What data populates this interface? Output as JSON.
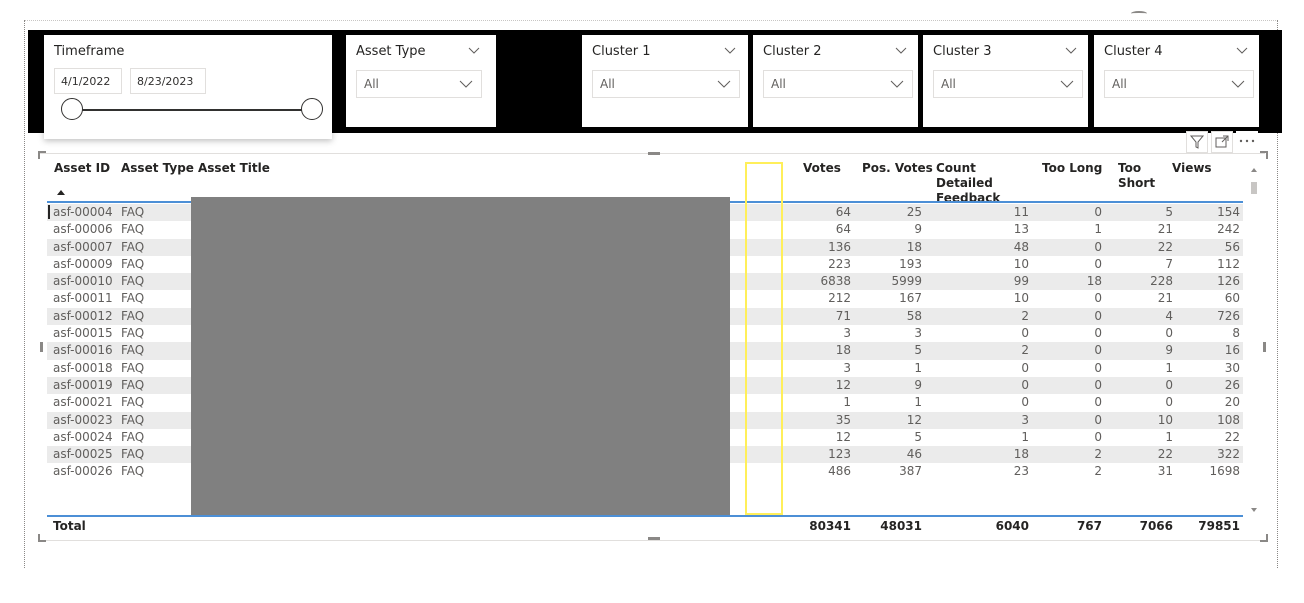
{
  "timeframe": {
    "title": "Timeframe",
    "start_date": "4/1/2022",
    "end_date": "8/23/2023"
  },
  "slicers": [
    {
      "title": "Asset Type",
      "value": "All"
    },
    {
      "title": "Cluster 1",
      "value": "All"
    },
    {
      "title": "Cluster 2",
      "value": "All"
    },
    {
      "title": "Cluster 3",
      "value": "All"
    },
    {
      "title": "Cluster 4",
      "value": "All"
    }
  ],
  "icons": [
    "filter-icon",
    "focus-mode-icon",
    "more-options-icon",
    "chevron-down-icon",
    "sort-ascending-icon"
  ],
  "colors": {
    "accent": "#4c8fd6",
    "highlight": "#ffef5a",
    "band": "#000000",
    "redaction": "#808080",
    "row_alt": "#ebebeb"
  },
  "table": {
    "columns": [
      "Asset ID",
      "Asset Type",
      "Asset Title",
      "Votes",
      "Pos. Votes",
      "Count Detailed Feedback",
      "Too Long",
      "Too Short",
      "Views"
    ],
    "rows": [
      [
        "asf-00004",
        "FAQ",
        "64",
        "25",
        "11",
        "0",
        "5",
        "154"
      ],
      [
        "asf-00006",
        "FAQ",
        "64",
        "9",
        "13",
        "1",
        "21",
        "242"
      ],
      [
        "asf-00007",
        "FAQ",
        "136",
        "18",
        "48",
        "0",
        "22",
        "56"
      ],
      [
        "asf-00009",
        "FAQ",
        "223",
        "193",
        "10",
        "0",
        "7",
        "112"
      ],
      [
        "asf-00010",
        "FAQ",
        "6838",
        "5999",
        "99",
        "18",
        "228",
        "126"
      ],
      [
        "asf-00011",
        "FAQ",
        "212",
        "167",
        "10",
        "0",
        "21",
        "60"
      ],
      [
        "asf-00012",
        "FAQ",
        "71",
        "58",
        "2",
        "0",
        "4",
        "726"
      ],
      [
        "asf-00015",
        "FAQ",
        "3",
        "3",
        "0",
        "0",
        "0",
        "8"
      ],
      [
        "asf-00016",
        "FAQ",
        "18",
        "5",
        "2",
        "0",
        "9",
        "16"
      ],
      [
        "asf-00018",
        "FAQ",
        "3",
        "1",
        "0",
        "0",
        "1",
        "30"
      ],
      [
        "asf-00019",
        "FAQ",
        "12",
        "9",
        "0",
        "0",
        "0",
        "26"
      ],
      [
        "asf-00021",
        "FAQ",
        "1",
        "1",
        "0",
        "0",
        "0",
        "20"
      ],
      [
        "asf-00023",
        "FAQ",
        "35",
        "12",
        "3",
        "0",
        "10",
        "108"
      ],
      [
        "asf-00024",
        "FAQ",
        "12",
        "5",
        "1",
        "0",
        "1",
        "22"
      ],
      [
        "asf-00025",
        "FAQ",
        "123",
        "46",
        "18",
        "2",
        "22",
        "322"
      ],
      [
        "asf-00026",
        "FAQ",
        "486",
        "387",
        "23",
        "2",
        "31",
        "1698"
      ]
    ],
    "total": {
      "label": "Total",
      "values": [
        "80341",
        "48031",
        "6040",
        "767",
        "7066",
        "79851"
      ]
    }
  }
}
